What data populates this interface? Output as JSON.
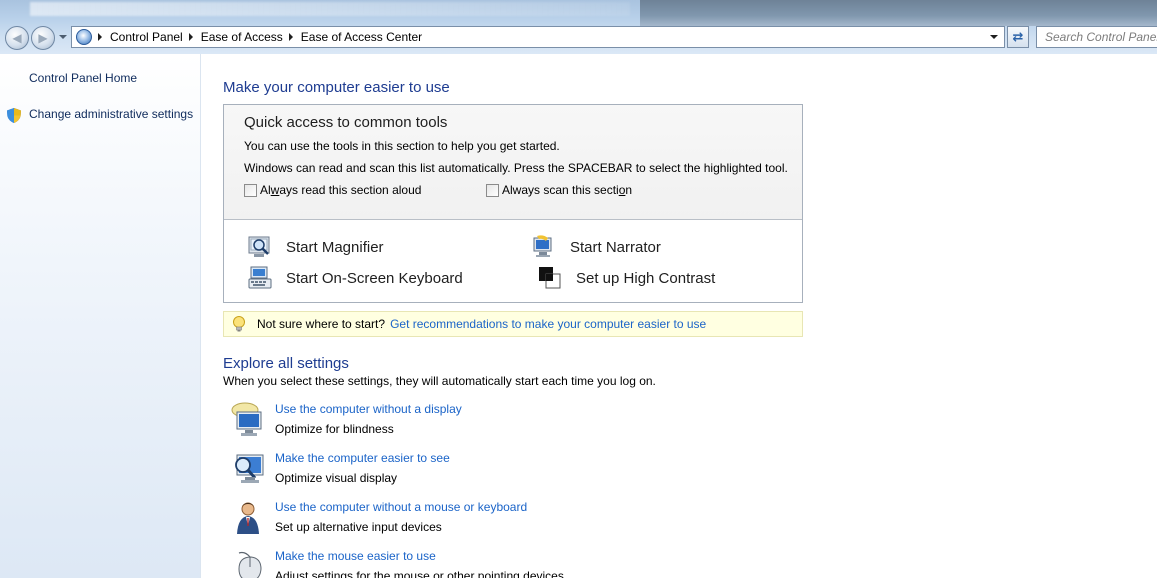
{
  "address_bar": {
    "breadcrumbs": [
      "Control Panel",
      "Ease of Access",
      "Ease of Access Center"
    ]
  },
  "search": {
    "placeholder": "Search Control Panel"
  },
  "sidebar": {
    "home_label": "Control Panel Home",
    "admin_label": "Change administrative settings"
  },
  "main": {
    "title": "Make your computer easier to use",
    "quick_access": {
      "title": "Quick access to common tools",
      "line1": "You can use the tools in this section to help you get started.",
      "line2": "Windows can read and scan this list automatically.  Press the SPACEBAR to select the highlighted tool.",
      "checkbox_read": {
        "pre": "Al",
        "underlined": "w",
        "post": "ays read this section aloud",
        "checked": false
      },
      "checkbox_scan": {
        "pre": "Always scan this secti",
        "underlined": "o",
        "post": "n",
        "checked": false
      },
      "tools": {
        "magnifier": "Start Magnifier",
        "narrator": "Start Narrator",
        "osk": "Start On-Screen Keyboard",
        "high_contrast": "Set up High Contrast"
      }
    },
    "tip": {
      "text": "Not sure where to start?",
      "link": "Get recommendations to make your computer easier to use"
    },
    "explore": {
      "title": "Explore all settings",
      "subtitle": "When you select these settings, they will automatically start each time you log on.",
      "items": [
        {
          "link": "Use the computer without a display",
          "desc": "Optimize for blindness"
        },
        {
          "link": "Make the computer easier to see",
          "desc": "Optimize visual display"
        },
        {
          "link": "Use the computer without a mouse or keyboard",
          "desc": "Set up alternative input devices"
        },
        {
          "link": "Make the mouse easier to use",
          "desc": "Adjust settings for the mouse or other pointing devices"
        }
      ]
    }
  },
  "colors": {
    "heading_blue": "#1e3c91",
    "link_blue": "#1b64c8",
    "tip_background": "#ffffe1"
  }
}
